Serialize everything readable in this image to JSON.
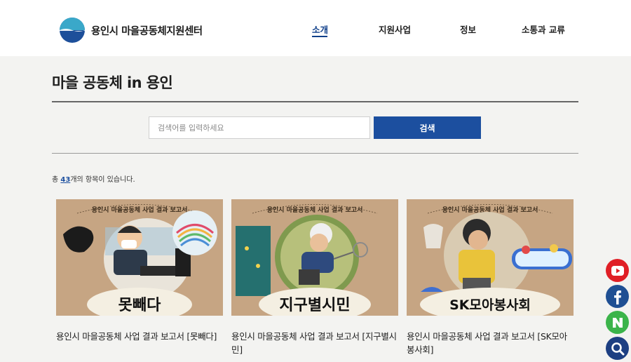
{
  "header": {
    "logo_text": "용인시 마을공동체지원센터",
    "nav": [
      {
        "label": "소개",
        "active": true
      },
      {
        "label": "지원사업",
        "active": false
      },
      {
        "label": "정보",
        "active": false
      },
      {
        "label": "소통과 교류",
        "active": false
      }
    ]
  },
  "main": {
    "title": "마을 공동체 in 용인",
    "search": {
      "placeholder": "검색어를 입력하세요",
      "button": "검색"
    },
    "count_prefix": "총 ",
    "count_value": "43",
    "count_suffix": "개의 항목이 있습니다.",
    "cards": [
      {
        "thumb_banner": "용인시 마을공동체 사업 결과 보고서",
        "thumb_caption": "못빼다",
        "title": "용인시 마을공동체 사업 결과 보고서 [못빼다]"
      },
      {
        "thumb_banner": "용인시 마을공동체 사업 결과 보고서",
        "thumb_caption": "지구별시민",
        "title": "용인시 마을공동체 사업 결과 보고서 [지구별시민]"
      },
      {
        "thumb_banner": "용인시 마을공동체 사업 결과 보고서",
        "thumb_caption": "SK모아봉사회",
        "title": "용인시 마을공동체 사업 결과 보고서 [SK모아봉사회]"
      }
    ]
  },
  "social": [
    {
      "icon": "youtube-icon",
      "color": "#e01f26"
    },
    {
      "icon": "facebook-icon",
      "color": "#1f4f93"
    },
    {
      "icon": "naver-icon",
      "color": "#3bb44a"
    },
    {
      "icon": "search-icon",
      "color": "#1d3f82"
    }
  ]
}
